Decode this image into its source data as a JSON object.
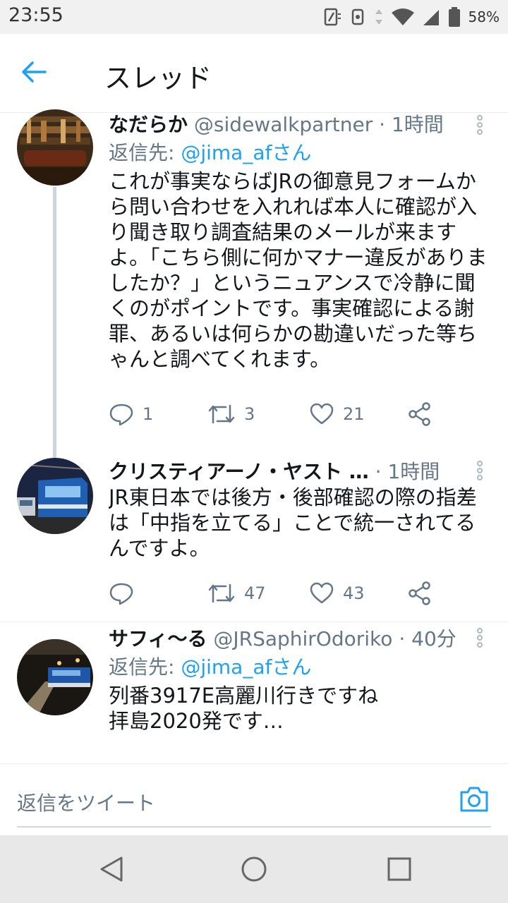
{
  "status_bar": {
    "time": "23:55",
    "battery": "58%"
  },
  "header": {
    "title": "スレッド"
  },
  "tweets": [
    {
      "name": "なだらか",
      "handle": "@sidewalkpartner",
      "separator": "·",
      "time": "1時間",
      "reply_prefix": "返信先: ",
      "reply_mention": "@jima_afさん",
      "text": "これが事実ならばJRの御意見フォームから問い合わせを入れれば本人に確認が入り聞き取り調査結果のメールが来ますよ。「こちら側に何かマナー違反がありましたか？」というニュアンスで冷静に聞くのがポイントです。事実確認による謝罪、あるいは何らかの勘違いだった等ちゃんと調べてくれます。",
      "replies": "1",
      "retweets": "3",
      "likes": "21"
    },
    {
      "name": "クリスティアーノ・ヤスト …",
      "handle": "",
      "separator": "·",
      "time": "1時間",
      "text": "JR東日本では後方・後部確認の際の指差は「中指を立てる」ことで統一されてるんですよ。",
      "replies": "",
      "retweets": "47",
      "likes": "43"
    },
    {
      "name": "サフィ〜る",
      "handle": "@JRSaphirOdoriko",
      "separator": "·",
      "time": "40分",
      "reply_prefix": "返信先: ",
      "reply_mention": "@jima_afさん",
      "text": "列番3917E高麗川行きですね\n拝島2020発です…"
    }
  ],
  "compose": {
    "placeholder": "返信をツイート"
  },
  "icons": {
    "back": "arrow-left-icon",
    "reply": "reply-bubble-icon",
    "retweet": "retweet-icon",
    "like": "heart-icon",
    "share": "share-icon",
    "menu": "more-vertical-icon",
    "camera": "camera-icon"
  },
  "colors": {
    "accent": "#1da1f2",
    "secondary_text": "#657786",
    "primary_text": "#14171a"
  }
}
